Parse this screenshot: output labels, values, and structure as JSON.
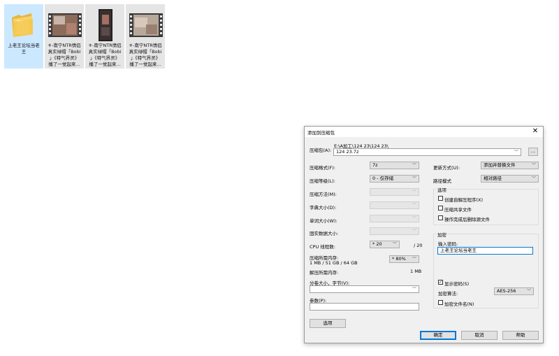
{
  "explorer": {
    "files": [
      {
        "caption": "上老王论坛当老\n王",
        "icon": "folder-icon"
      },
      {
        "caption": "⚜-南宁NTR情侣\n真实绿帽「Bobi\n」《特气界灵》\n播了一觉起来...",
        "icon": "video-thumbnail-icon"
      },
      {
        "caption": "⚜-南宁NTR情侣\n真实绿帽「Bobi\n」《特气界灵》\n播了一觉起来...",
        "icon": "video-thumbnail-icon"
      },
      {
        "caption": "⚜-南宁NTR情侣\n真实绿帽「Bobi\n」《特气界灵》\n播了一觉起来...",
        "icon": "video-thumbnail-icon"
      }
    ]
  },
  "dialog": {
    "title": "添加到压缩包",
    "close_glyph": "✕",
    "archive": {
      "label": "压缩包(A):",
      "path": "E:\\A加工\\124 23\\124 23\\",
      "value": "124 23.7z",
      "browse_label": "..."
    },
    "left": {
      "format_label": "压缩格式(F):",
      "format_value": "7z",
      "level_label": "压缩等级(L):",
      "level_value": "0 - 仅存储",
      "method_label": "压缩方法(M):",
      "dict_label": "字典大小(D):",
      "word_label": "单词大小(W):",
      "solid_label": "固实数据大小:",
      "cpu_label": "CPU 线程数:",
      "cpu_value": "* 20",
      "cpu_total": "/ 20",
      "mem_comp_label": "压缩所需内存:",
      "mem_comp_detail": "1 MB / 51 GB / 64 GB",
      "mem_comp_value": "* 80%",
      "mem_decomp_label": "解压所需内存:",
      "mem_decomp_value": "1 MB",
      "split_label": "分卷大小，字节(V):",
      "split_value": "",
      "params_label": "参数(P):",
      "params_value": "",
      "options_button": "选项"
    },
    "right": {
      "update_label": "更新方式(U):",
      "update_value": "添加并替换文件",
      "path_label": "路径模式",
      "path_value": "相对路径",
      "options_group": "选项",
      "opt_sfx": "创建自解压程序(X)",
      "opt_shared": "压缩共享文件",
      "opt_delete": "操作完成后删除源文件",
      "encrypt_group": "加密",
      "password_label": "输入密码:",
      "password_value": "上老王论坛当老王",
      "show_password": "显示密码(S)",
      "show_password_checked": "✓",
      "enc_method_label": "加密算法:",
      "enc_method_value": "AES-256",
      "encrypt_names": "加密文件名(N)"
    },
    "buttons": {
      "ok": "确定",
      "cancel": "取消",
      "help": "帮助"
    }
  },
  "colors": {
    "accent": "#0078d7",
    "selection": "#cce8ff",
    "dialog_bg": "#f0f0f0"
  }
}
